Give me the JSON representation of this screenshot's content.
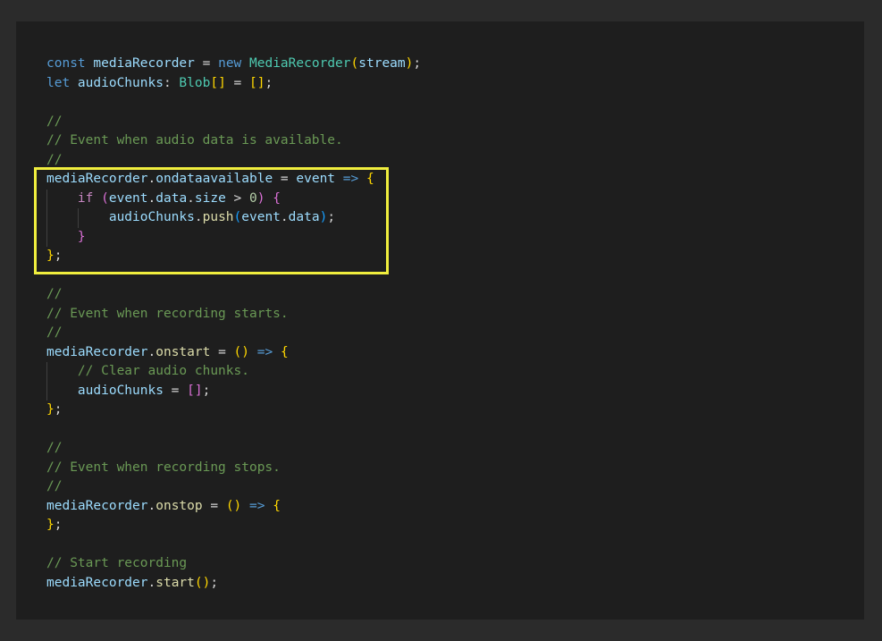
{
  "code": {
    "lines": [
      [
        {
          "t": "const ",
          "c": "k"
        },
        {
          "t": "mediaRecorder",
          "c": "v"
        },
        {
          "t": " = ",
          "c": "p"
        },
        {
          "t": "new ",
          "c": "k"
        },
        {
          "t": "MediaRecorder",
          "c": "t"
        },
        {
          "t": "(",
          "c": "b1"
        },
        {
          "t": "stream",
          "c": "v"
        },
        {
          "t": ")",
          "c": "b1"
        },
        {
          "t": ";",
          "c": "p"
        }
      ],
      [
        {
          "t": "let ",
          "c": "k"
        },
        {
          "t": "audioChunks",
          "c": "v"
        },
        {
          "t": ": ",
          "c": "p"
        },
        {
          "t": "Blob",
          "c": "t"
        },
        {
          "t": "[]",
          "c": "b1"
        },
        {
          "t": " = ",
          "c": "p"
        },
        {
          "t": "[]",
          "c": "b1"
        },
        {
          "t": ";",
          "c": "p"
        }
      ],
      [],
      [
        {
          "t": "//",
          "c": "c"
        }
      ],
      [
        {
          "t": "// Event when audio data is available.",
          "c": "c"
        }
      ],
      [
        {
          "t": "//",
          "c": "c"
        }
      ],
      [
        {
          "t": "mediaRecorder",
          "c": "v"
        },
        {
          "t": ".",
          "c": "p"
        },
        {
          "t": "ondataavailable",
          "c": "v"
        },
        {
          "t": " = ",
          "c": "p"
        },
        {
          "t": "event",
          "c": "v"
        },
        {
          "t": " => ",
          "c": "k"
        },
        {
          "t": "{",
          "c": "b1"
        }
      ],
      [
        {
          "t": "    ",
          "c": "p"
        },
        {
          "t": "if ",
          "c": "ctl"
        },
        {
          "t": "(",
          "c": "b2"
        },
        {
          "t": "event",
          "c": "v"
        },
        {
          "t": ".",
          "c": "p"
        },
        {
          "t": "data",
          "c": "v"
        },
        {
          "t": ".",
          "c": "p"
        },
        {
          "t": "size",
          "c": "v"
        },
        {
          "t": " > ",
          "c": "p"
        },
        {
          "t": "0",
          "c": "n"
        },
        {
          "t": ")",
          "c": "b2"
        },
        {
          "t": " ",
          "c": "p"
        },
        {
          "t": "{",
          "c": "b2"
        }
      ],
      [
        {
          "t": "        ",
          "c": "p"
        },
        {
          "t": "audioChunks",
          "c": "v"
        },
        {
          "t": ".",
          "c": "p"
        },
        {
          "t": "push",
          "c": "f"
        },
        {
          "t": "(",
          "c": "b3"
        },
        {
          "t": "event",
          "c": "v"
        },
        {
          "t": ".",
          "c": "p"
        },
        {
          "t": "data",
          "c": "v"
        },
        {
          "t": ")",
          "c": "b3"
        },
        {
          "t": ";",
          "c": "p"
        }
      ],
      [
        {
          "t": "    ",
          "c": "p"
        },
        {
          "t": "}",
          "c": "b2"
        }
      ],
      [
        {
          "t": "}",
          "c": "b1"
        },
        {
          "t": ";",
          "c": "p"
        }
      ],
      [],
      [
        {
          "t": "//",
          "c": "c"
        }
      ],
      [
        {
          "t": "// Event when recording starts.",
          "c": "c"
        }
      ],
      [
        {
          "t": "//",
          "c": "c"
        }
      ],
      [
        {
          "t": "mediaRecorder",
          "c": "v"
        },
        {
          "t": ".",
          "c": "p"
        },
        {
          "t": "onstart",
          "c": "f"
        },
        {
          "t": " = ",
          "c": "p"
        },
        {
          "t": "()",
          "c": "b1"
        },
        {
          "t": " => ",
          "c": "k"
        },
        {
          "t": "{",
          "c": "b1"
        }
      ],
      [
        {
          "t": "    ",
          "c": "p"
        },
        {
          "t": "// Clear audio chunks.",
          "c": "c"
        }
      ],
      [
        {
          "t": "    ",
          "c": "p"
        },
        {
          "t": "audioChunks",
          "c": "v"
        },
        {
          "t": " = ",
          "c": "p"
        },
        {
          "t": "[]",
          "c": "b2"
        },
        {
          "t": ";",
          "c": "p"
        }
      ],
      [
        {
          "t": "}",
          "c": "b1"
        },
        {
          "t": ";",
          "c": "p"
        }
      ],
      [],
      [
        {
          "t": "//",
          "c": "c"
        }
      ],
      [
        {
          "t": "// Event when recording stops.",
          "c": "c"
        }
      ],
      [
        {
          "t": "//",
          "c": "c"
        }
      ],
      [
        {
          "t": "mediaRecorder",
          "c": "v"
        },
        {
          "t": ".",
          "c": "p"
        },
        {
          "t": "onstop",
          "c": "f"
        },
        {
          "t": " = ",
          "c": "p"
        },
        {
          "t": "()",
          "c": "b1"
        },
        {
          "t": " => ",
          "c": "k"
        },
        {
          "t": "{",
          "c": "b1"
        }
      ],
      [
        {
          "t": "}",
          "c": "b1"
        },
        {
          "t": ";",
          "c": "p"
        }
      ],
      [],
      [
        {
          "t": "// Start recording",
          "c": "c"
        }
      ],
      [
        {
          "t": "mediaRecorder",
          "c": "v"
        },
        {
          "t": ".",
          "c": "p"
        },
        {
          "t": "start",
          "c": "f"
        },
        {
          "t": "()",
          "c": "b1"
        },
        {
          "t": ";",
          "c": "p"
        }
      ]
    ],
    "highlight_color": "#f0ee3e",
    "background_color": "#1e1e1e"
  }
}
